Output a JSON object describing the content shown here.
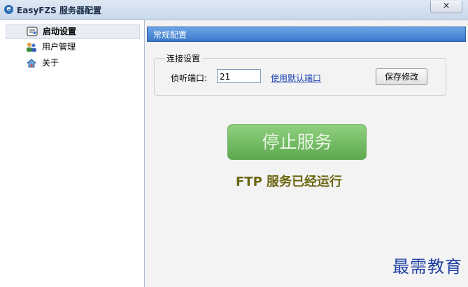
{
  "window": {
    "title": "EasyFZS 服务器配置",
    "close_label": "×"
  },
  "sidebar": {
    "items": [
      {
        "label": "启动设置",
        "icon": "startup-settings-icon",
        "selected": true
      },
      {
        "label": "用户管理",
        "icon": "user-management-icon",
        "selected": false
      },
      {
        "label": "关于",
        "icon": "about-icon",
        "selected": false
      }
    ]
  },
  "main": {
    "section_title": "常规配置",
    "connection_group": {
      "title": "连接设置",
      "port_label": "侦听端口:",
      "port_value": "21",
      "default_port_link": "使用默认端口",
      "save_button": "保存修改"
    },
    "stop_button": "停止服务",
    "status": "FTP 服务已经运行"
  },
  "watermark": "最需教育",
  "colors": {
    "header_blue": "#3b78c9",
    "stop_button_green": "#6cb85c",
    "status_text": "#6b6510",
    "link_blue": "#1a3fb3",
    "watermark_blue": "#1f3fa3"
  }
}
